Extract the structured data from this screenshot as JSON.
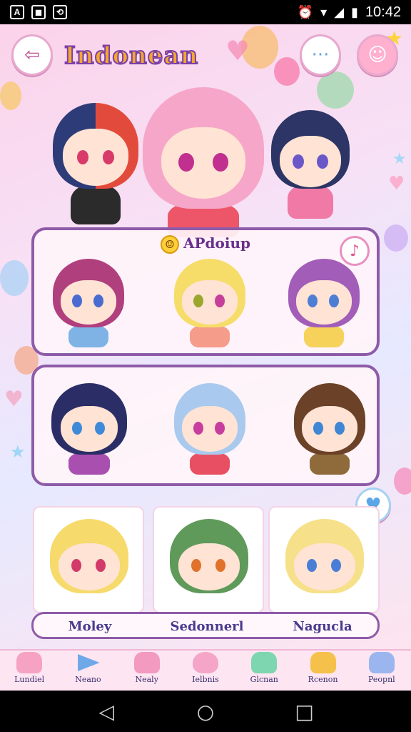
{
  "statusbar": {
    "left_icons": [
      "A",
      "◼",
      "⟲"
    ],
    "alarm_icon": "⏰",
    "wifi_icon": "▾",
    "signal_icon": "◢",
    "battery_icon": "▮",
    "time": "10:42"
  },
  "header": {
    "back_icon": "⇦",
    "title": "Indonean",
    "chat_icon": "···",
    "emoji_icon": "☺"
  },
  "panel_one": {
    "title": "APdoiup",
    "action_icon": "♪"
  },
  "featured": {
    "names": [
      "Moley",
      "Sedonnerl",
      "Nagucla"
    ]
  },
  "tabs": [
    {
      "label": "Lundiel",
      "color": "#f6a3c3"
    },
    {
      "label": "Neano",
      "color": "#6fa8e8"
    },
    {
      "label": "Nealy",
      "color": "#f29ac0"
    },
    {
      "label": "Ielbnis",
      "color": "#f5a5c8"
    },
    {
      "label": "Glcnan",
      "color": "#7dd6b0"
    },
    {
      "label": "Rcenon",
      "color": "#f6c14b"
    },
    {
      "label": "Peopnl",
      "color": "#9bb6ee"
    }
  ],
  "navbar": {
    "back": "◁",
    "home": "○",
    "recents": "□"
  }
}
